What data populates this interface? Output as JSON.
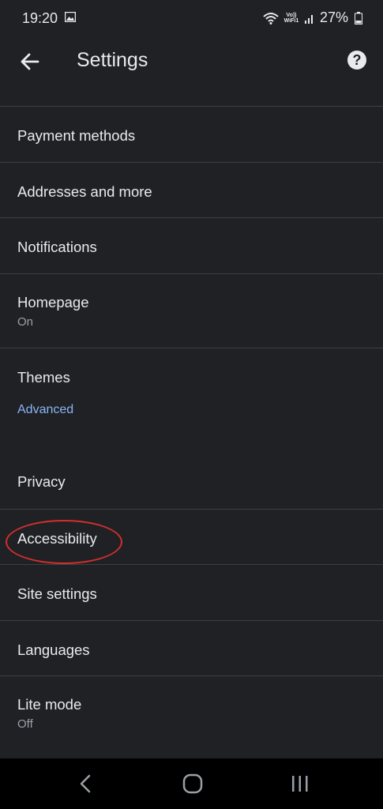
{
  "status_bar": {
    "time": "19:20",
    "volte_top": "Vo))",
    "volte_bottom": "WiFi1",
    "battery_percent": "27%"
  },
  "app_bar": {
    "title": "Settings"
  },
  "settings_items": [
    {
      "label": "Payment methods"
    },
    {
      "label": "Addresses and more"
    },
    {
      "label": "Notifications"
    },
    {
      "label": "Homepage",
      "sub": "On"
    },
    {
      "label": "Themes"
    },
    {
      "label": "Privacy"
    },
    {
      "label": "Accessibility"
    },
    {
      "label": "Site settings"
    },
    {
      "label": "Languages"
    },
    {
      "label": "Lite mode",
      "sub": "Off"
    }
  ],
  "section_header": "Advanced",
  "colors": {
    "background": "#202124",
    "text": "#e8eaed",
    "secondary_text": "#9aa0a6",
    "accent": "#8ab4f8",
    "annotation_circle": "#d32f2f"
  },
  "icons": {
    "back": "arrow-left-icon",
    "help": "help-icon",
    "nav_back": "chevron-left-icon",
    "nav_home": "home-icon",
    "nav_recents": "recents-icon"
  }
}
